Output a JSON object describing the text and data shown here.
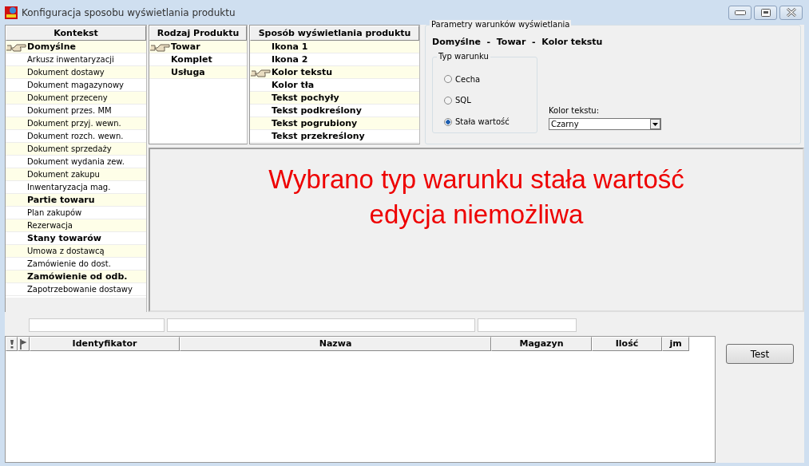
{
  "window": {
    "title": "Konfiguracja sposobu wyświetlania produktu"
  },
  "kontekst": {
    "header": "Kontekst",
    "items": [
      {
        "label": "Domyślne",
        "bold": true,
        "selected": true
      },
      {
        "label": "Arkusz inwentaryzacji",
        "bold": false,
        "selected": false
      },
      {
        "label": "Dokument dostawy",
        "bold": false,
        "selected": false
      },
      {
        "label": "Dokument magazynowy",
        "bold": false,
        "selected": false
      },
      {
        "label": "Dokument przeceny",
        "bold": false,
        "selected": false
      },
      {
        "label": "Dokument przes. MM",
        "bold": false,
        "selected": false
      },
      {
        "label": "Dokument przyj. wewn.",
        "bold": false,
        "selected": false
      },
      {
        "label": "Dokument rozch. wewn.",
        "bold": false,
        "selected": false
      },
      {
        "label": "Dokument sprzedaży",
        "bold": false,
        "selected": false
      },
      {
        "label": "Dokument wydania zew.",
        "bold": false,
        "selected": false
      },
      {
        "label": "Dokument zakupu",
        "bold": false,
        "selected": false
      },
      {
        "label": "Inwentaryzacja mag.",
        "bold": false,
        "selected": false
      },
      {
        "label": "Partie towaru",
        "bold": true,
        "selected": false
      },
      {
        "label": "Plan zakupów",
        "bold": false,
        "selected": false
      },
      {
        "label": "Rezerwacja",
        "bold": false,
        "selected": false
      },
      {
        "label": "Stany towarów",
        "bold": true,
        "selected": false
      },
      {
        "label": "Umowa z dostawcą",
        "bold": false,
        "selected": false
      },
      {
        "label": "Zamówienie do dost.",
        "bold": false,
        "selected": false
      },
      {
        "label": "Zamówienie od odb.",
        "bold": true,
        "selected": false
      },
      {
        "label": "Zapotrzebowanie dostawy",
        "bold": false,
        "selected": false
      }
    ]
  },
  "rodzaj": {
    "header": "Rodzaj Produktu",
    "items": [
      {
        "label": "Towar",
        "bold": true,
        "selected": true
      },
      {
        "label": "Komplet",
        "bold": true,
        "selected": false
      },
      {
        "label": "Usługa",
        "bold": true,
        "selected": false
      }
    ]
  },
  "sposob": {
    "header": "Sposób wyświetlania produktu",
    "items": [
      {
        "label": "Ikona 1",
        "bold": true,
        "selected": false
      },
      {
        "label": "Ikona 2",
        "bold": true,
        "selected": false
      },
      {
        "label": "Kolor tekstu",
        "bold": true,
        "selected": true
      },
      {
        "label": "Kolor tła",
        "bold": true,
        "selected": false
      },
      {
        "label": "Tekst pochyły",
        "bold": true,
        "selected": false
      },
      {
        "label": "Tekst podkreślony",
        "bold": true,
        "selected": false
      },
      {
        "label": "Tekst pogrubiony",
        "bold": true,
        "selected": false
      },
      {
        "label": "Tekst przekreślony",
        "bold": true,
        "selected": false
      }
    ]
  },
  "parametry": {
    "title": "Parametry warunków wyświetlania",
    "path": "Domyślne  -  Towar  -  Kolor tekstu",
    "typ_warunku": {
      "title": "Typ warunku",
      "options": [
        {
          "label": "Cecha",
          "selected": false
        },
        {
          "label": "SQL",
          "selected": false
        },
        {
          "label": "Stała wartość",
          "selected": true
        }
      ]
    },
    "kolor_tekstu": {
      "label": "Kolor tekstu:",
      "value": "Czarny"
    }
  },
  "message": "Wybrano typ warunku stała wartość edycja niemożliwa",
  "table": {
    "columns": [
      "Identyfikator",
      "Nazwa",
      "Magazyn",
      "Ilość",
      "jm"
    ]
  },
  "buttons": [
    "Test"
  ]
}
